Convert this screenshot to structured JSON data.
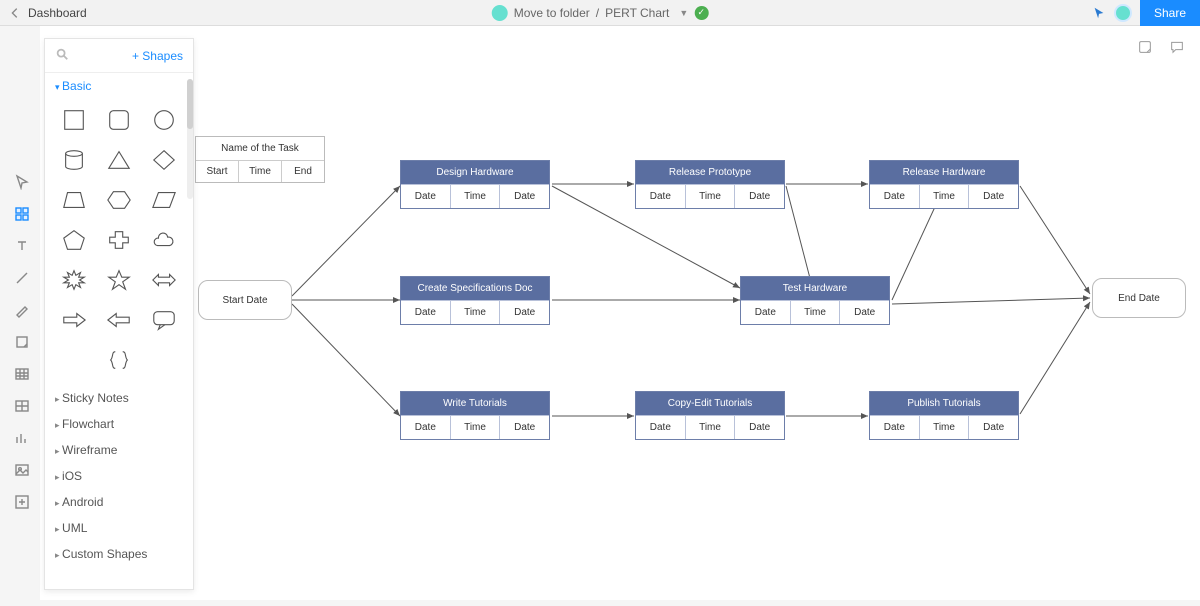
{
  "header": {
    "back_label": "Dashboard",
    "breadcrumb_folder": "Move to folder",
    "breadcrumb_file": "PERT Chart",
    "share_label": "Share"
  },
  "shapes_panel": {
    "add_shapes_label": "Shapes",
    "categories": {
      "basic": "Basic",
      "sticky": "Sticky Notes",
      "flowchart": "Flowchart",
      "wireframe": "Wireframe",
      "ios": "iOS",
      "android": "Android",
      "uml": "UML",
      "custom": "Custom Shapes"
    }
  },
  "legend_box": {
    "title": "Name of the Task",
    "c1": "Start",
    "c2": "Time",
    "c3": "End"
  },
  "cells": {
    "date": "Date",
    "time": "Time"
  },
  "nodes": {
    "start": "Start Date",
    "end": "End Date",
    "design_hardware": "Design Hardware",
    "release_prototype": "Release Prototype",
    "release_hardware": "Release Hardware",
    "create_spec": "Create Specifications Doc",
    "test_hardware": "Test Hardware",
    "write_tutorials": "Write Tutorials",
    "copyedit_tutorials": "Copy-Edit Tutorials",
    "publish_tutorials": "Publish Tutorials"
  },
  "colors": {
    "task_header": "#5a6ea0",
    "accent": "#1a8cff"
  }
}
